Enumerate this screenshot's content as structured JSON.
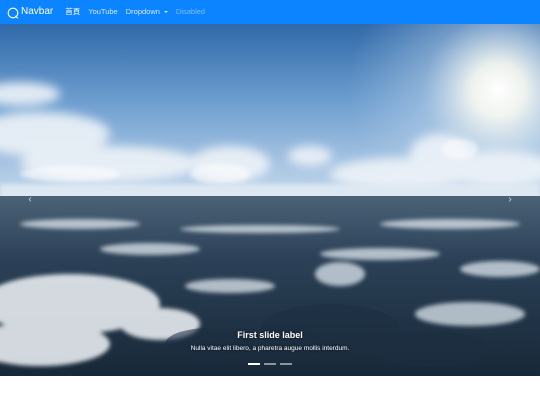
{
  "navbar": {
    "brand_label": "Navbar",
    "brand_icon": "brand-circle-icon",
    "items": [
      {
        "label": "首頁",
        "state": "active"
      },
      {
        "label": "YouTube",
        "state": "normal"
      },
      {
        "label": "Dropdown",
        "state": "normal",
        "dropdown": true
      },
      {
        "label": "Disabled",
        "state": "disabled"
      }
    ],
    "background_color": "#0d84ff"
  },
  "carousel": {
    "caption_title": "First slide label",
    "caption_text": "Nulla vitae elit libero, a pharetra augue mollis interdum.",
    "prev_icon": "chevron-left-icon",
    "next_icon": "chevron-right-icon",
    "prev_glyph": "‹",
    "next_glyph": "›",
    "indicators": {
      "count": 3,
      "active_index": 0
    }
  }
}
